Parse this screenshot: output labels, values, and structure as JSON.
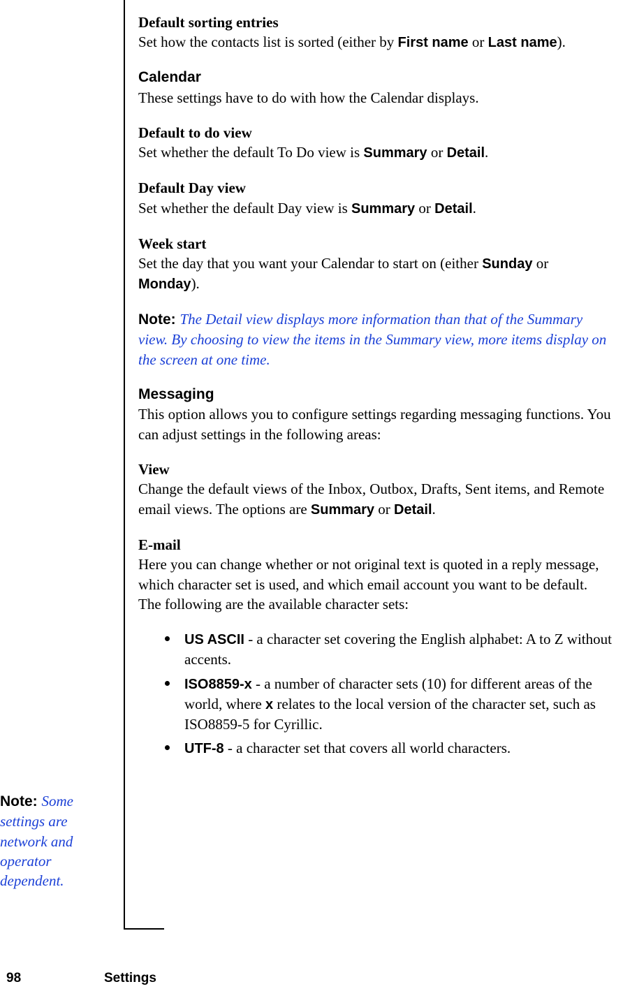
{
  "sections": {
    "defaultSorting": {
      "title": "Default sorting entries",
      "body_a": "Set how the contacts list is sorted (either by ",
      "first": "First name",
      "mid": " or ",
      "last": "Last name",
      "body_b": ")."
    },
    "calendar": {
      "title": "Calendar",
      "body": "These settings have to do with how the Calendar displays."
    },
    "todo": {
      "title": "Default to do view",
      "body_a": "Set whether the default To Do view is ",
      "summary": "Summary",
      "mid": " or ",
      "detail": "Detail",
      "body_b": "."
    },
    "day": {
      "title": "Default Day view",
      "body_a": "Set whether the default Day view is ",
      "summary": "Summary",
      "mid": " or ",
      "detail": "Detail",
      "body_b": "."
    },
    "week": {
      "title": "Week start",
      "body_a": "Set the day that you want your Calendar to start on (either ",
      "sunday": "Sunday",
      "mid": " or ",
      "monday": "Monday",
      "body_b": ")."
    },
    "note1": {
      "label": "Note:  ",
      "body": "The Detail view displays more information than that of the Summary view. By choosing to view the items in the Summary view, more items display on the screen at one time."
    },
    "messaging": {
      "title": "Messaging",
      "body": "This option allows you to configure settings regarding messaging functions. You can adjust settings in the following areas:"
    },
    "view": {
      "title": "View",
      "body_a": "Change the default views of the Inbox, Outbox, Drafts, Sent items, and Remote email views. The options are ",
      "summary": "Summary",
      "mid": " or ",
      "detail": "Detail",
      "body_b": "."
    },
    "email": {
      "title": "E-mail",
      "body": "Here you can change whether or not original text is quoted in a reply message, which character set is used, and which email account you want to be default. The following are the available character sets:"
    }
  },
  "charsets": {
    "ascii": {
      "name": "US ASCII",
      "desc": " - a character set covering the English alphabet: A to Z without accents."
    },
    "iso": {
      "name": "ISO8859-x",
      "desc_a": " - a number of character sets (10) for different areas of the world, where ",
      "x": "x",
      "desc_b": " relates to the local version of the character set, such as ISO8859-5 for Cyrillic."
    },
    "utf8": {
      "name": "UTF-8",
      "desc": " - a character set that covers all world characters."
    }
  },
  "sidenote": {
    "label": "Note:  ",
    "body": "Some settings are network and operator dependent."
  },
  "footer": {
    "page": "98",
    "title": "Settings"
  }
}
